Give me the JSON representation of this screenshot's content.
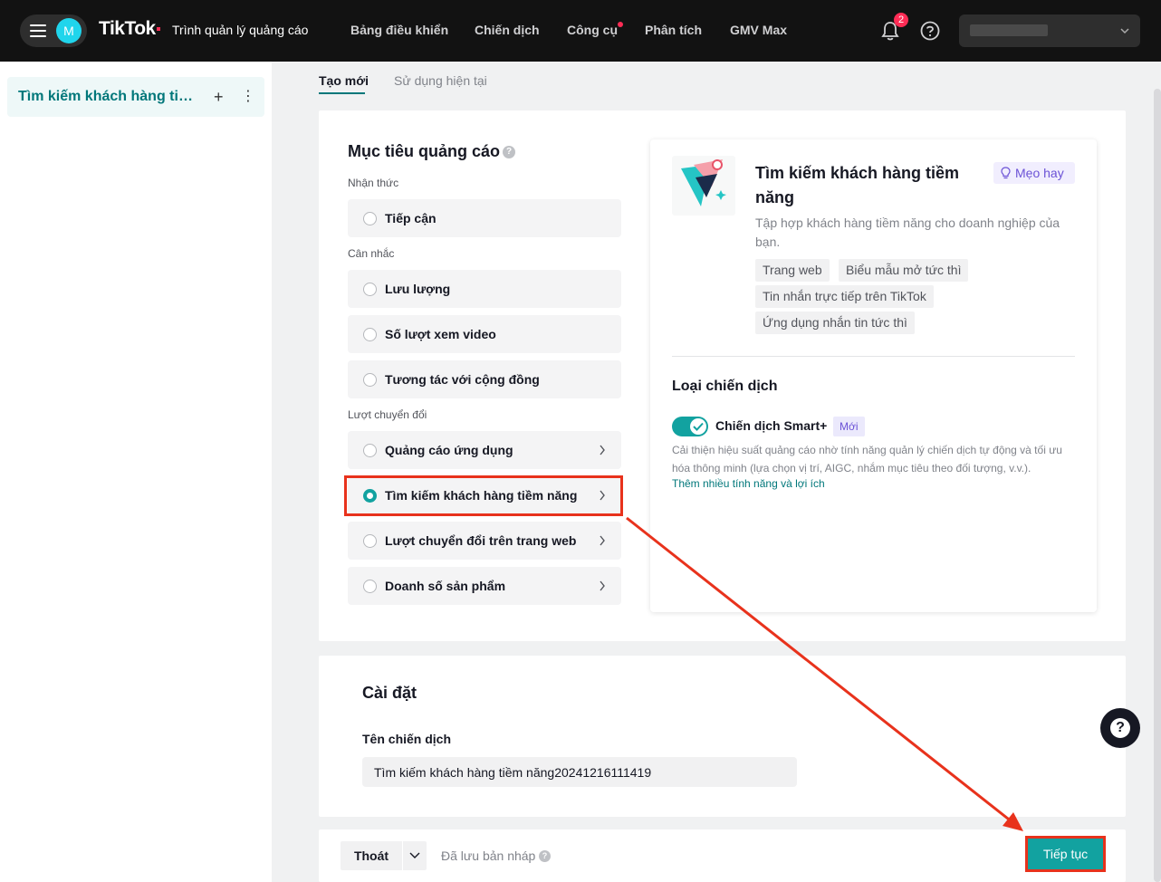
{
  "topbar": {
    "avatar_letter": "M",
    "logo": "TikTok",
    "logo_sub": "Trình quản lý quảng cáo",
    "nav": [
      "Bảng điều khiển",
      "Chiến dịch",
      "Công cụ",
      "Phân tích",
      "GMV Max"
    ],
    "notification_count": "2"
  },
  "sidebar": {
    "item_label": "Tìm kiếm khách hàng tiềm năng"
  },
  "tabs": {
    "create": "Tạo mới",
    "existing": "Sử dụng hiện tại"
  },
  "objective": {
    "title": "Mục tiêu quảng cáo",
    "groups": {
      "awareness": "Nhận thức",
      "consideration": "Cân nhắc",
      "conversion": "Lượt chuyển đổi"
    },
    "options": {
      "reach": "Tiếp cận",
      "traffic": "Lưu lượng",
      "video_views": "Số lượt xem video",
      "community": "Tương tác với cộng đồng",
      "app": "Quảng cáo ứng dụng",
      "leads": "Tìm kiếm khách hàng tiềm năng",
      "web_conv": "Lượt chuyển đổi trên trang web",
      "sales": "Doanh số sản phẩm"
    },
    "selected": "leads"
  },
  "detail": {
    "title": "Tìm kiếm khách hàng tiềm năng",
    "tip": "Mẹo hay",
    "desc": "Tập hợp khách hàng tiềm năng cho doanh nghiệp của bạn.",
    "chips": [
      "Trang web",
      "Biểu mẫu mở tức thì",
      "Tin nhắn trực tiếp trên TikTok",
      "Ứng dụng nhắn tin tức thì"
    ],
    "campaign_type_title": "Loại chiến dịch",
    "smart_label": "Chiến dịch Smart+",
    "new_badge": "Mới",
    "smart_desc": "Cải thiện hiệu suất quảng cáo nhờ tính năng quản lý chiến dịch tự động và tối ưu hóa thông minh (lựa chọn vị trí, AIGC, nhắm mục tiêu theo đối tượng, v.v.).",
    "smart_link": "Thêm nhiều tính năng và lợi ích"
  },
  "settings": {
    "title": "Cài đặt",
    "name_label": "Tên chiến dịch",
    "name_value": "Tìm kiếm khách hàng tiềm năng20241216111419"
  },
  "footer": {
    "exit": "Thoát",
    "draft": "Đã lưu bản nháp",
    "continue": "Tiếp tục"
  },
  "colors": {
    "accent": "#12a2a0",
    "highlight": "#e8321c",
    "topbar": "#121212"
  }
}
